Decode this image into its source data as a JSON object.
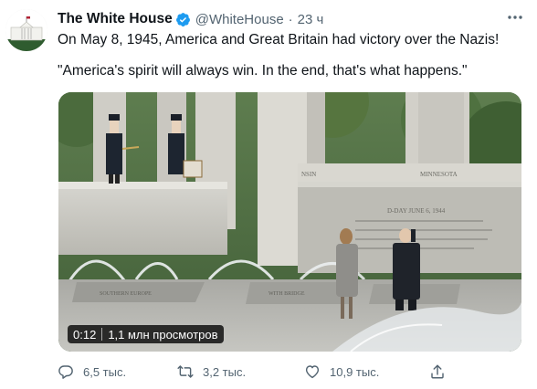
{
  "tweet": {
    "display_name": "The White House",
    "handle": "@WhiteHouse",
    "separator": "·",
    "time": "23 ч",
    "text_line1": "On May 8, 1945, America and Great Britain had victory over the Nazis!",
    "text_line2": "\"America's spirit will always win. In the end, that's what happens.\""
  },
  "media": {
    "duration": "0:12",
    "views": "1,1 млн просмотров",
    "memorial_inscriptions": [
      "NSIN",
      "MINNESOTA",
      "D-DAY JUNE 6, 1944",
      "SOUTHERN EUROPE",
      "WITH BRIDGE"
    ]
  },
  "actions": {
    "replies": "6,5 тыс.",
    "retweets": "3,2 тыс.",
    "likes": "10,9 тыс."
  },
  "colors": {
    "text": "#0f1419",
    "secondary": "#536471",
    "verified_blue": "#1d9bf0"
  },
  "icons": {
    "verified": "verified-badge-icon",
    "more": "more-dots-icon",
    "reply": "reply-icon",
    "retweet": "retweet-icon",
    "like": "heart-icon",
    "share": "share-icon"
  }
}
